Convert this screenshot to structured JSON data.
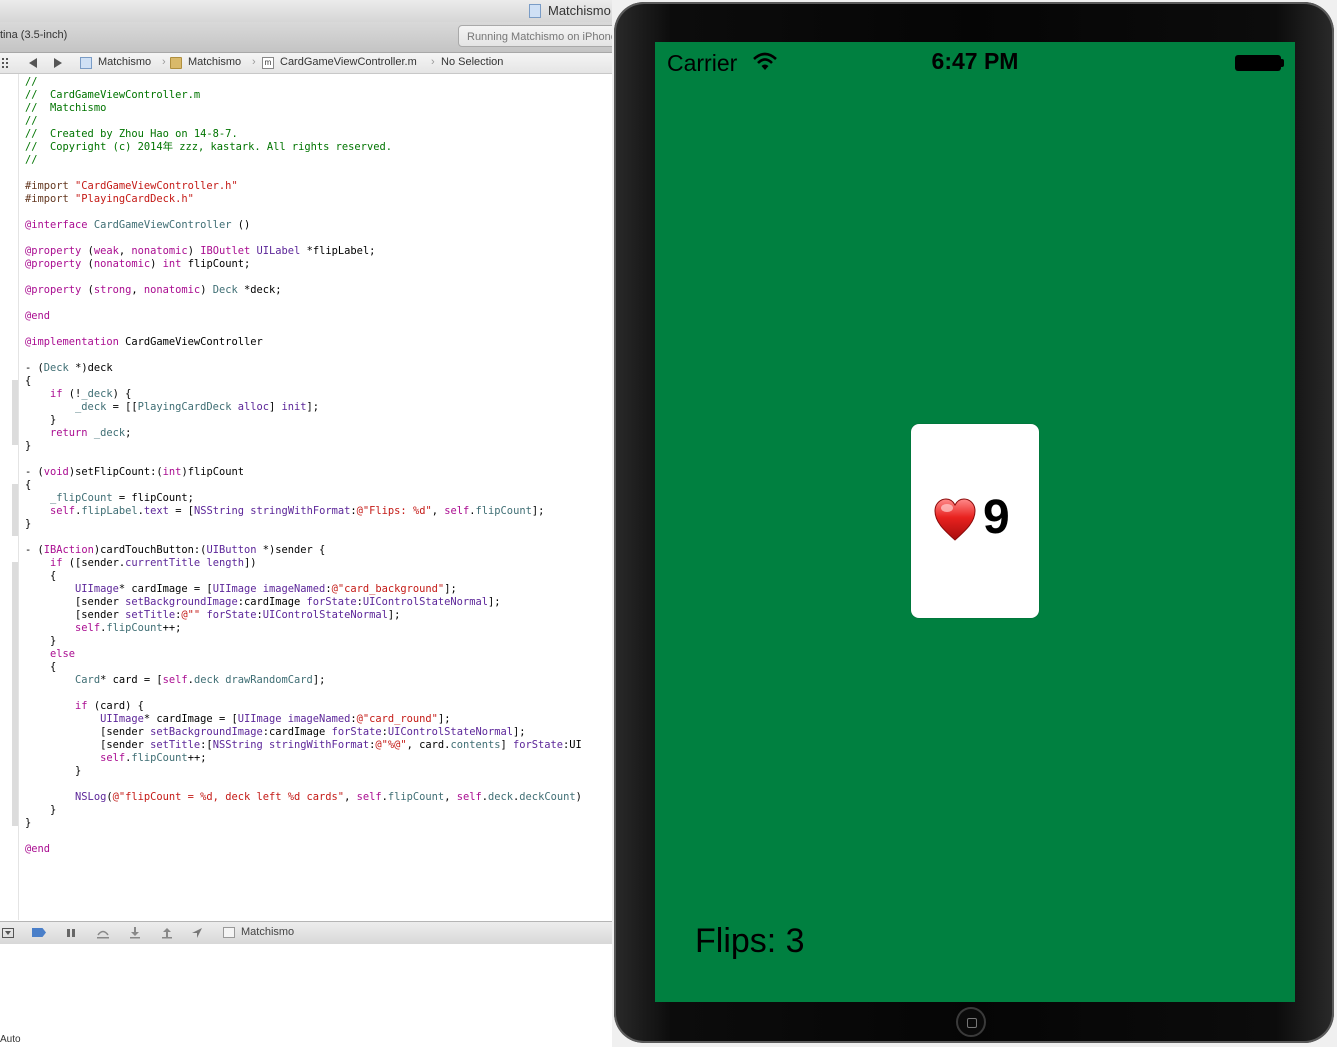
{
  "xcode": {
    "window_title": "Matchismo",
    "scheme_label": "tina (3.5-inch)",
    "status_text": "Running Matchismo on iPhone",
    "jumpbar": {
      "crumbs": [
        "Matchismo",
        "Matchismo",
        "CardGameViewController.m",
        "No Selection"
      ]
    },
    "code_lines": [
      [
        [
          "//",
          "c"
        ]
      ],
      [
        [
          "//  CardGameViewController.m",
          "c"
        ]
      ],
      [
        [
          "//  Matchismo",
          "c"
        ]
      ],
      [
        [
          "//",
          "c"
        ]
      ],
      [
        [
          "//  Created by Zhou Hao on 14-8-7.",
          "c"
        ]
      ],
      [
        [
          "//  Copyright (c) 2014年 zzz, kastark. All rights reserved.",
          "c"
        ]
      ],
      [
        [
          "//",
          "c"
        ]
      ],
      [],
      [
        [
          "#import ",
          "p"
        ],
        [
          "\"CardGameViewController.h\"",
          "s"
        ]
      ],
      [
        [
          "#import ",
          "p"
        ],
        [
          "\"PlayingCardDeck.h\"",
          "s"
        ]
      ],
      [],
      [
        [
          "@interface ",
          "k"
        ],
        [
          "CardGameViewController",
          "j"
        ],
        [
          " ()",
          ""
        ]
      ],
      [],
      [
        [
          "@property ",
          "k"
        ],
        [
          "(",
          ""
        ],
        [
          "weak",
          "k"
        ],
        [
          ", ",
          ""
        ],
        [
          "nonatomic",
          "k"
        ],
        [
          ") ",
          ""
        ],
        [
          "IBOutlet ",
          "k"
        ],
        [
          "UILabel",
          "t"
        ],
        [
          " *flipLabel;",
          ""
        ]
      ],
      [
        [
          "@property ",
          "k"
        ],
        [
          "(",
          ""
        ],
        [
          "nonatomic",
          "k"
        ],
        [
          ") ",
          ""
        ],
        [
          "int",
          "k"
        ],
        [
          " flipCount;",
          ""
        ]
      ],
      [],
      [
        [
          "@property ",
          "k"
        ],
        [
          "(",
          ""
        ],
        [
          "strong",
          "k"
        ],
        [
          ", ",
          ""
        ],
        [
          "nonatomic",
          "k"
        ],
        [
          ") ",
          ""
        ],
        [
          "Deck",
          "j"
        ],
        [
          " *deck;",
          ""
        ]
      ],
      [],
      [
        [
          "@end",
          "k"
        ]
      ],
      [],
      [
        [
          "@implementation ",
          "k"
        ],
        [
          "CardGameViewController",
          ""
        ]
      ],
      [],
      [
        [
          "- (",
          ""
        ],
        [
          "Deck",
          "j"
        ],
        [
          " *)deck",
          ""
        ]
      ],
      [
        [
          "{",
          ""
        ]
      ],
      [
        [
          "    ",
          ""
        ],
        [
          "if",
          "k"
        ],
        [
          " (!",
          ""
        ],
        [
          "_deck",
          "j"
        ],
        [
          ") {",
          ""
        ]
      ],
      [
        [
          "        ",
          ""
        ],
        [
          "_deck",
          "j"
        ],
        [
          " = [[",
          ""
        ],
        [
          "PlayingCardDeck",
          "j"
        ],
        [
          " ",
          ""
        ],
        [
          "alloc",
          "t"
        ],
        [
          "] ",
          ""
        ],
        [
          "init",
          "t"
        ],
        [
          "];",
          ""
        ]
      ],
      [
        [
          "    }",
          ""
        ]
      ],
      [
        [
          "    ",
          ""
        ],
        [
          "return",
          "k"
        ],
        [
          " ",
          ""
        ],
        [
          "_deck",
          "j"
        ],
        [
          ";",
          ""
        ]
      ],
      [
        [
          "}",
          ""
        ]
      ],
      [],
      [
        [
          "- (",
          ""
        ],
        [
          "void",
          "k"
        ],
        [
          ")setFlipCount:(",
          ""
        ],
        [
          "int",
          "k"
        ],
        [
          ")flipCount",
          ""
        ]
      ],
      [
        [
          "{",
          ""
        ]
      ],
      [
        [
          "    ",
          ""
        ],
        [
          "_flipCount",
          "j"
        ],
        [
          " = flipCount;",
          ""
        ]
      ],
      [
        [
          "    ",
          ""
        ],
        [
          "self",
          "k"
        ],
        [
          ".",
          ""
        ],
        [
          "flipLabel",
          "j"
        ],
        [
          ".",
          ""
        ],
        [
          "text",
          "t"
        ],
        [
          " = [",
          ""
        ],
        [
          "NSString",
          "t"
        ],
        [
          " ",
          ""
        ],
        [
          "stringWithFormat",
          "t"
        ],
        [
          ":",
          ""
        ],
        [
          "@\"Flips: %d\"",
          "s"
        ],
        [
          ", ",
          ""
        ],
        [
          "self",
          "k"
        ],
        [
          ".",
          ""
        ],
        [
          "flipCount",
          "j"
        ],
        [
          "];",
          ""
        ]
      ],
      [
        [
          "}",
          ""
        ]
      ],
      [],
      [
        [
          "- (",
          ""
        ],
        [
          "IBAction",
          "k"
        ],
        [
          ")cardTouchButton:(",
          ""
        ],
        [
          "UIButton",
          "t"
        ],
        [
          " *)sender {",
          ""
        ]
      ],
      [
        [
          "    ",
          ""
        ],
        [
          "if",
          "k"
        ],
        [
          " ([sender.",
          ""
        ],
        [
          "currentTitle",
          "t"
        ],
        [
          " ",
          ""
        ],
        [
          "length",
          "t"
        ],
        [
          "])",
          ""
        ]
      ],
      [
        [
          "    {",
          ""
        ]
      ],
      [
        [
          "        ",
          ""
        ],
        [
          "UIImage",
          "t"
        ],
        [
          "* cardImage = [",
          ""
        ],
        [
          "UIImage",
          "t"
        ],
        [
          " ",
          ""
        ],
        [
          "imageNamed",
          "t"
        ],
        [
          ":",
          ""
        ],
        [
          "@\"card_background\"",
          "s"
        ],
        [
          "];",
          ""
        ]
      ],
      [
        [
          "        [sender ",
          ""
        ],
        [
          "setBackgroundImage",
          "t"
        ],
        [
          ":cardImage ",
          ""
        ],
        [
          "forState",
          "t"
        ],
        [
          ":",
          ""
        ],
        [
          "UIControlStateNormal",
          "t"
        ],
        [
          "];",
          ""
        ]
      ],
      [
        [
          "        [sender ",
          ""
        ],
        [
          "setTitle",
          "t"
        ],
        [
          ":",
          ""
        ],
        [
          "@\"\"",
          "s"
        ],
        [
          " ",
          ""
        ],
        [
          "forState",
          "t"
        ],
        [
          ":",
          ""
        ],
        [
          "UIControlStateNormal",
          "t"
        ],
        [
          "];",
          ""
        ]
      ],
      [
        [
          "        ",
          ""
        ],
        [
          "self",
          "k"
        ],
        [
          ".",
          ""
        ],
        [
          "flipCount",
          "j"
        ],
        [
          "++;",
          ""
        ]
      ],
      [
        [
          "    }",
          ""
        ]
      ],
      [
        [
          "    ",
          ""
        ],
        [
          "else",
          "k"
        ]
      ],
      [
        [
          "    {",
          ""
        ]
      ],
      [
        [
          "        ",
          ""
        ],
        [
          "Card",
          "j"
        ],
        [
          "* card = [",
          ""
        ],
        [
          "self",
          "k"
        ],
        [
          ".",
          ""
        ],
        [
          "deck",
          "j"
        ],
        [
          " ",
          ""
        ],
        [
          "drawRandomCard",
          "j"
        ],
        [
          "];",
          ""
        ]
      ],
      [],
      [
        [
          "        ",
          ""
        ],
        [
          "if",
          "k"
        ],
        [
          " (card) {",
          ""
        ]
      ],
      [
        [
          "            ",
          ""
        ],
        [
          "UIImage",
          "t"
        ],
        [
          "* cardImage = [",
          ""
        ],
        [
          "UIImage",
          "t"
        ],
        [
          " ",
          ""
        ],
        [
          "imageNamed",
          "t"
        ],
        [
          ":",
          ""
        ],
        [
          "@\"card_round\"",
          "s"
        ],
        [
          "];",
          ""
        ]
      ],
      [
        [
          "            [sender ",
          ""
        ],
        [
          "setBackgroundImage",
          "t"
        ],
        [
          ":cardImage ",
          ""
        ],
        [
          "forState",
          "t"
        ],
        [
          ":",
          ""
        ],
        [
          "UIControlStateNormal",
          "t"
        ],
        [
          "];",
          ""
        ]
      ],
      [
        [
          "            [sender ",
          ""
        ],
        [
          "setTitle",
          "t"
        ],
        [
          ":[",
          ""
        ],
        [
          "NSString",
          "t"
        ],
        [
          " ",
          ""
        ],
        [
          "stringWithFormat",
          "t"
        ],
        [
          ":",
          ""
        ],
        [
          "@\"%@\"",
          "s"
        ],
        [
          ", card.",
          ""
        ],
        [
          "contents",
          "j"
        ],
        [
          "] ",
          ""
        ],
        [
          "forState",
          "t"
        ],
        [
          ":UI",
          ""
        ]
      ],
      [
        [
          "            ",
          ""
        ],
        [
          "self",
          "k"
        ],
        [
          ".",
          ""
        ],
        [
          "flipCount",
          "j"
        ],
        [
          "++;",
          ""
        ]
      ],
      [
        [
          "        }",
          ""
        ]
      ],
      [],
      [
        [
          "        ",
          ""
        ],
        [
          "NSLog",
          "t"
        ],
        [
          "(",
          ""
        ],
        [
          "@\"flipCount = %d, deck left %d cards\"",
          "s"
        ],
        [
          ", ",
          ""
        ],
        [
          "self",
          "k"
        ],
        [
          ".",
          ""
        ],
        [
          "flipCount",
          "j"
        ],
        [
          ", ",
          ""
        ],
        [
          "self",
          "k"
        ],
        [
          ".",
          ""
        ],
        [
          "deck",
          "j"
        ],
        [
          ".",
          ""
        ],
        [
          "deckCount",
          "j"
        ],
        [
          ")",
          ""
        ]
      ],
      [
        [
          "    }",
          ""
        ]
      ],
      [
        [
          "}",
          ""
        ]
      ],
      [],
      [
        [
          "@end",
          "k"
        ]
      ]
    ],
    "debugbar_target": "Matchismo",
    "console_scope": "Auto"
  },
  "simulator": {
    "carrier": "Carrier",
    "time": "6:47 PM",
    "card_rank": "9",
    "card_suit_icon": "heart-icon",
    "flips_label": "Flips: 3",
    "background_color": "#008040"
  }
}
